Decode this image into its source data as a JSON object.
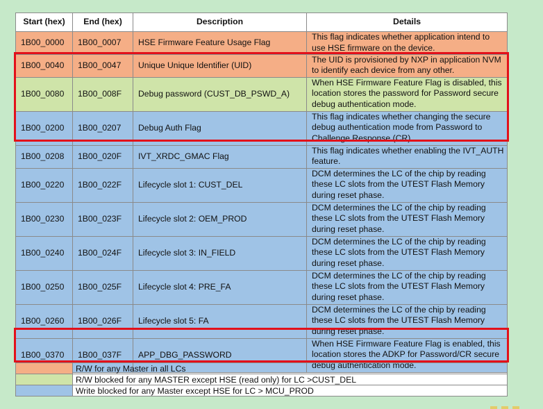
{
  "table": {
    "headers": [
      "Start (hex)",
      "End (hex)",
      "Description",
      "Details"
    ],
    "rows": [
      {
        "start": "1B00_0000",
        "end": "1B00_0007",
        "description": "HSE Firmware Feature Usage Flag",
        "details": "This flag indicates whether application intend to use HSE firmware on the device.",
        "color": "#f5ae86"
      },
      {
        "start": "1B00_0040",
        "end": "1B00_0047",
        "description": "Unique Unique Identifier (UID)",
        "details": "The UID is provisioned by NXP in application NVM to identify each device from any other.",
        "color": "#f5ae86"
      },
      {
        "start": "1B00_0080",
        "end": "1B00_008F",
        "description": "Debug password (CUST_DB_PSWD_A)",
        "details": "When HSE Firmware Feature Flag is disabled, this location stores the password for Password secure debug authentication mode.",
        "color": "#cfe4a9"
      },
      {
        "start": "1B00_0200",
        "end": "1B00_0207",
        "description": "Debug Auth Flag",
        "details": "This flag indicates whether changing the secure debug authentication mode from Password to Challenge Response (CR).",
        "color": "#9fc3e6"
      },
      {
        "start": "1B00_0208",
        "end": "1B00_020F",
        "description": "IVT_XRDC_GMAC Flag",
        "details": "This flag indicates whether enabling the IVT_AUTH feature.",
        "color": "#9fc3e6"
      },
      {
        "start": "1B00_0220",
        "end": "1B00_022F",
        "description": "Lifecycle slot 1: CUST_DEL",
        "details": "DCM determines the LC of the chip by reading these LC slots from the UTEST Flash Memory during reset phase.",
        "color": "#9fc3e6"
      },
      {
        "start": "1B00_0230",
        "end": "1B00_023F",
        "description": "Lifecycle slot 2: OEM_PROD",
        "details": "DCM determines the LC of the chip by reading these LC slots from the UTEST Flash Memory during reset phase.",
        "color": "#9fc3e6"
      },
      {
        "start": "1B00_0240",
        "end": "1B00_024F",
        "description": "Lifecycle slot 3: IN_FIELD",
        "details": "DCM determines the LC of the chip by reading these LC slots from the UTEST Flash Memory during reset phase.",
        "color": "#9fc3e6"
      },
      {
        "start": "1B00_0250",
        "end": "1B00_025F",
        "description": "Lifecycle slot 4: PRE_FA",
        "details": "DCM determines the LC of the chip by reading these LC slots from the UTEST Flash Memory during reset phase.",
        "color": "#9fc3e6"
      },
      {
        "start": "1B00_0260",
        "end": "1B00_026F",
        "description": "Lifecycle slot 5: FA",
        "details": "DCM determines the LC of the chip by reading these LC slots from the UTEST Flash Memory during reset phase.",
        "color": "#9fc3e6"
      },
      {
        "start": "1B00_0370",
        "end": "1B00_037F",
        "description": "APP_DBG_PASSWORD",
        "details": "When HSE Firmware Feature Flag is enabled, this location stores the ADKP for Password/CR secure debug authentication mode.",
        "color": "#9fc3e6"
      }
    ]
  },
  "legend": [
    {
      "color": "#f5ae86",
      "text": "R/W for any Master in all LCs"
    },
    {
      "color": "#cfe4a9",
      "text": "R/W blocked for any MASTER except HSE (read only) for LC >CUST_DEL"
    },
    {
      "color": "#9fc3e6",
      "text": "Write blocked for any Master except HSE for LC > MCU_PROD"
    }
  ],
  "colors": {
    "highlight_border": "#e3101a",
    "background": "#c6e9c9"
  }
}
